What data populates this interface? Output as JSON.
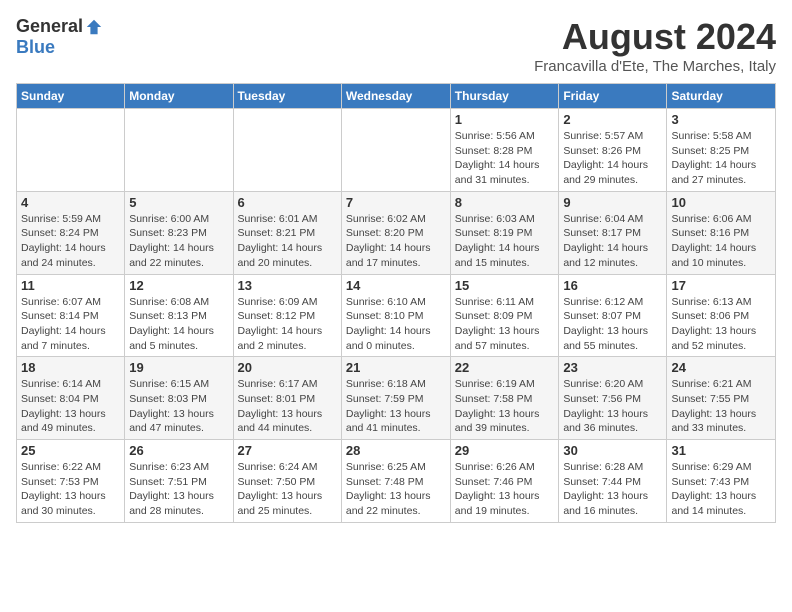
{
  "logo": {
    "general": "General",
    "blue": "Blue"
  },
  "title": "August 2024",
  "subtitle": "Francavilla d'Ete, The Marches, Italy",
  "days_of_week": [
    "Sunday",
    "Monday",
    "Tuesday",
    "Wednesday",
    "Thursday",
    "Friday",
    "Saturday"
  ],
  "weeks": [
    [
      {
        "day": "",
        "info": ""
      },
      {
        "day": "",
        "info": ""
      },
      {
        "day": "",
        "info": ""
      },
      {
        "day": "",
        "info": ""
      },
      {
        "day": "1",
        "info": "Sunrise: 5:56 AM\nSunset: 8:28 PM\nDaylight: 14 hours and 31 minutes."
      },
      {
        "day": "2",
        "info": "Sunrise: 5:57 AM\nSunset: 8:26 PM\nDaylight: 14 hours and 29 minutes."
      },
      {
        "day": "3",
        "info": "Sunrise: 5:58 AM\nSunset: 8:25 PM\nDaylight: 14 hours and 27 minutes."
      }
    ],
    [
      {
        "day": "4",
        "info": "Sunrise: 5:59 AM\nSunset: 8:24 PM\nDaylight: 14 hours and 24 minutes."
      },
      {
        "day": "5",
        "info": "Sunrise: 6:00 AM\nSunset: 8:23 PM\nDaylight: 14 hours and 22 minutes."
      },
      {
        "day": "6",
        "info": "Sunrise: 6:01 AM\nSunset: 8:21 PM\nDaylight: 14 hours and 20 minutes."
      },
      {
        "day": "7",
        "info": "Sunrise: 6:02 AM\nSunset: 8:20 PM\nDaylight: 14 hours and 17 minutes."
      },
      {
        "day": "8",
        "info": "Sunrise: 6:03 AM\nSunset: 8:19 PM\nDaylight: 14 hours and 15 minutes."
      },
      {
        "day": "9",
        "info": "Sunrise: 6:04 AM\nSunset: 8:17 PM\nDaylight: 14 hours and 12 minutes."
      },
      {
        "day": "10",
        "info": "Sunrise: 6:06 AM\nSunset: 8:16 PM\nDaylight: 14 hours and 10 minutes."
      }
    ],
    [
      {
        "day": "11",
        "info": "Sunrise: 6:07 AM\nSunset: 8:14 PM\nDaylight: 14 hours and 7 minutes."
      },
      {
        "day": "12",
        "info": "Sunrise: 6:08 AM\nSunset: 8:13 PM\nDaylight: 14 hours and 5 minutes."
      },
      {
        "day": "13",
        "info": "Sunrise: 6:09 AM\nSunset: 8:12 PM\nDaylight: 14 hours and 2 minutes."
      },
      {
        "day": "14",
        "info": "Sunrise: 6:10 AM\nSunset: 8:10 PM\nDaylight: 14 hours and 0 minutes."
      },
      {
        "day": "15",
        "info": "Sunrise: 6:11 AM\nSunset: 8:09 PM\nDaylight: 13 hours and 57 minutes."
      },
      {
        "day": "16",
        "info": "Sunrise: 6:12 AM\nSunset: 8:07 PM\nDaylight: 13 hours and 55 minutes."
      },
      {
        "day": "17",
        "info": "Sunrise: 6:13 AM\nSunset: 8:06 PM\nDaylight: 13 hours and 52 minutes."
      }
    ],
    [
      {
        "day": "18",
        "info": "Sunrise: 6:14 AM\nSunset: 8:04 PM\nDaylight: 13 hours and 49 minutes."
      },
      {
        "day": "19",
        "info": "Sunrise: 6:15 AM\nSunset: 8:03 PM\nDaylight: 13 hours and 47 minutes."
      },
      {
        "day": "20",
        "info": "Sunrise: 6:17 AM\nSunset: 8:01 PM\nDaylight: 13 hours and 44 minutes."
      },
      {
        "day": "21",
        "info": "Sunrise: 6:18 AM\nSunset: 7:59 PM\nDaylight: 13 hours and 41 minutes."
      },
      {
        "day": "22",
        "info": "Sunrise: 6:19 AM\nSunset: 7:58 PM\nDaylight: 13 hours and 39 minutes."
      },
      {
        "day": "23",
        "info": "Sunrise: 6:20 AM\nSunset: 7:56 PM\nDaylight: 13 hours and 36 minutes."
      },
      {
        "day": "24",
        "info": "Sunrise: 6:21 AM\nSunset: 7:55 PM\nDaylight: 13 hours and 33 minutes."
      }
    ],
    [
      {
        "day": "25",
        "info": "Sunrise: 6:22 AM\nSunset: 7:53 PM\nDaylight: 13 hours and 30 minutes."
      },
      {
        "day": "26",
        "info": "Sunrise: 6:23 AM\nSunset: 7:51 PM\nDaylight: 13 hours and 28 minutes."
      },
      {
        "day": "27",
        "info": "Sunrise: 6:24 AM\nSunset: 7:50 PM\nDaylight: 13 hours and 25 minutes."
      },
      {
        "day": "28",
        "info": "Sunrise: 6:25 AM\nSunset: 7:48 PM\nDaylight: 13 hours and 22 minutes."
      },
      {
        "day": "29",
        "info": "Sunrise: 6:26 AM\nSunset: 7:46 PM\nDaylight: 13 hours and 19 minutes."
      },
      {
        "day": "30",
        "info": "Sunrise: 6:28 AM\nSunset: 7:44 PM\nDaylight: 13 hours and 16 minutes."
      },
      {
        "day": "31",
        "info": "Sunrise: 6:29 AM\nSunset: 7:43 PM\nDaylight: 13 hours and 14 minutes."
      }
    ]
  ]
}
